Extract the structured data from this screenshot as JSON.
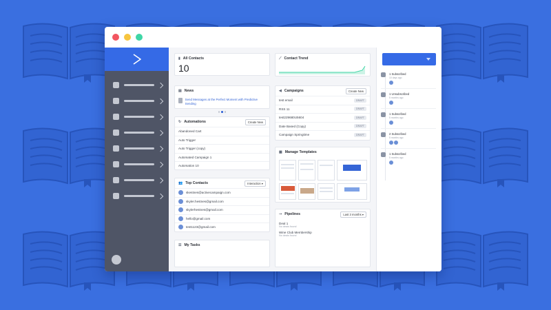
{
  "window": {
    "buttons": [
      "close",
      "minimize",
      "maximize"
    ]
  },
  "sidebar": {
    "logo_icon": "chevron-right-logo",
    "items": [
      {
        "icon": "nav-square"
      },
      {
        "icon": "nav-square"
      },
      {
        "icon": "nav-square"
      },
      {
        "icon": "nav-square"
      },
      {
        "icon": "nav-square"
      },
      {
        "icon": "nav-square"
      },
      {
        "icon": "nav-square"
      },
      {
        "icon": "nav-square"
      }
    ]
  },
  "all_contacts": {
    "title": "All Contacts",
    "count": "10"
  },
  "news": {
    "title": "News",
    "headline": "Send Messages at the Perfect Moment with Predictive Sending"
  },
  "automations": {
    "title": "Automations",
    "create_label": "Create New",
    "items": [
      "Abandoned Cart",
      "Auto Trigger",
      "Auto Trigger (copy)",
      "Automated Campaign 1",
      "Automation 10"
    ]
  },
  "top_contacts": {
    "title": "Top Contacts",
    "filter": "Interaction",
    "items": [
      "skestnes@activecampaign.com",
      "skyler.hestnes@gmail.com",
      "skylerhestnes@gmail.com",
      "hello@gmail.com",
      "test1123@gmail.com"
    ]
  },
  "my_tasks": {
    "title": "My Tasks"
  },
  "contact_trend": {
    "title": "Contact Trend"
  },
  "campaigns": {
    "title": "Campaigns",
    "create_label": "Create New",
    "items": [
      {
        "name": "test email",
        "status": "DRAFT"
      },
      {
        "name": "RSS 11",
        "status": "DRAFT"
      },
      {
        "name": "test229680U5604",
        "status": "DRAFT"
      },
      {
        "name": "Date Based (Copy)",
        "status": "DRAFT"
      },
      {
        "name": "Campaign Springtime",
        "status": "DRAFT"
      }
    ]
  },
  "templates": {
    "title": "Manage Templates"
  },
  "pipelines": {
    "title": "Pipelines",
    "filter": "Last 3 months",
    "items": [
      {
        "name": "Deal 1",
        "note": "No deals found"
      },
      {
        "name": "Wine Club Membership",
        "note": "No deals found"
      }
    ]
  },
  "activity": {
    "items": [
      {
        "title": "1 Subscribed",
        "time": "10 days ago",
        "avatars": 1
      },
      {
        "title": "1 Unsubscribed",
        "time": "5 months ago",
        "avatars": 1
      },
      {
        "title": "1 Subscribed",
        "time": "5 months ago",
        "avatars": 1
      },
      {
        "title": "2 Subscribed",
        "time": "5 months ago",
        "avatars": 2
      },
      {
        "title": "1 Subscribed",
        "time": "5 months ago",
        "avatars": 1
      }
    ]
  },
  "colors": {
    "background": "#3a6fe0",
    "brand_blue": "#356ae6",
    "sidebar": "#4f5566",
    "trend": "#3fd6a6"
  }
}
